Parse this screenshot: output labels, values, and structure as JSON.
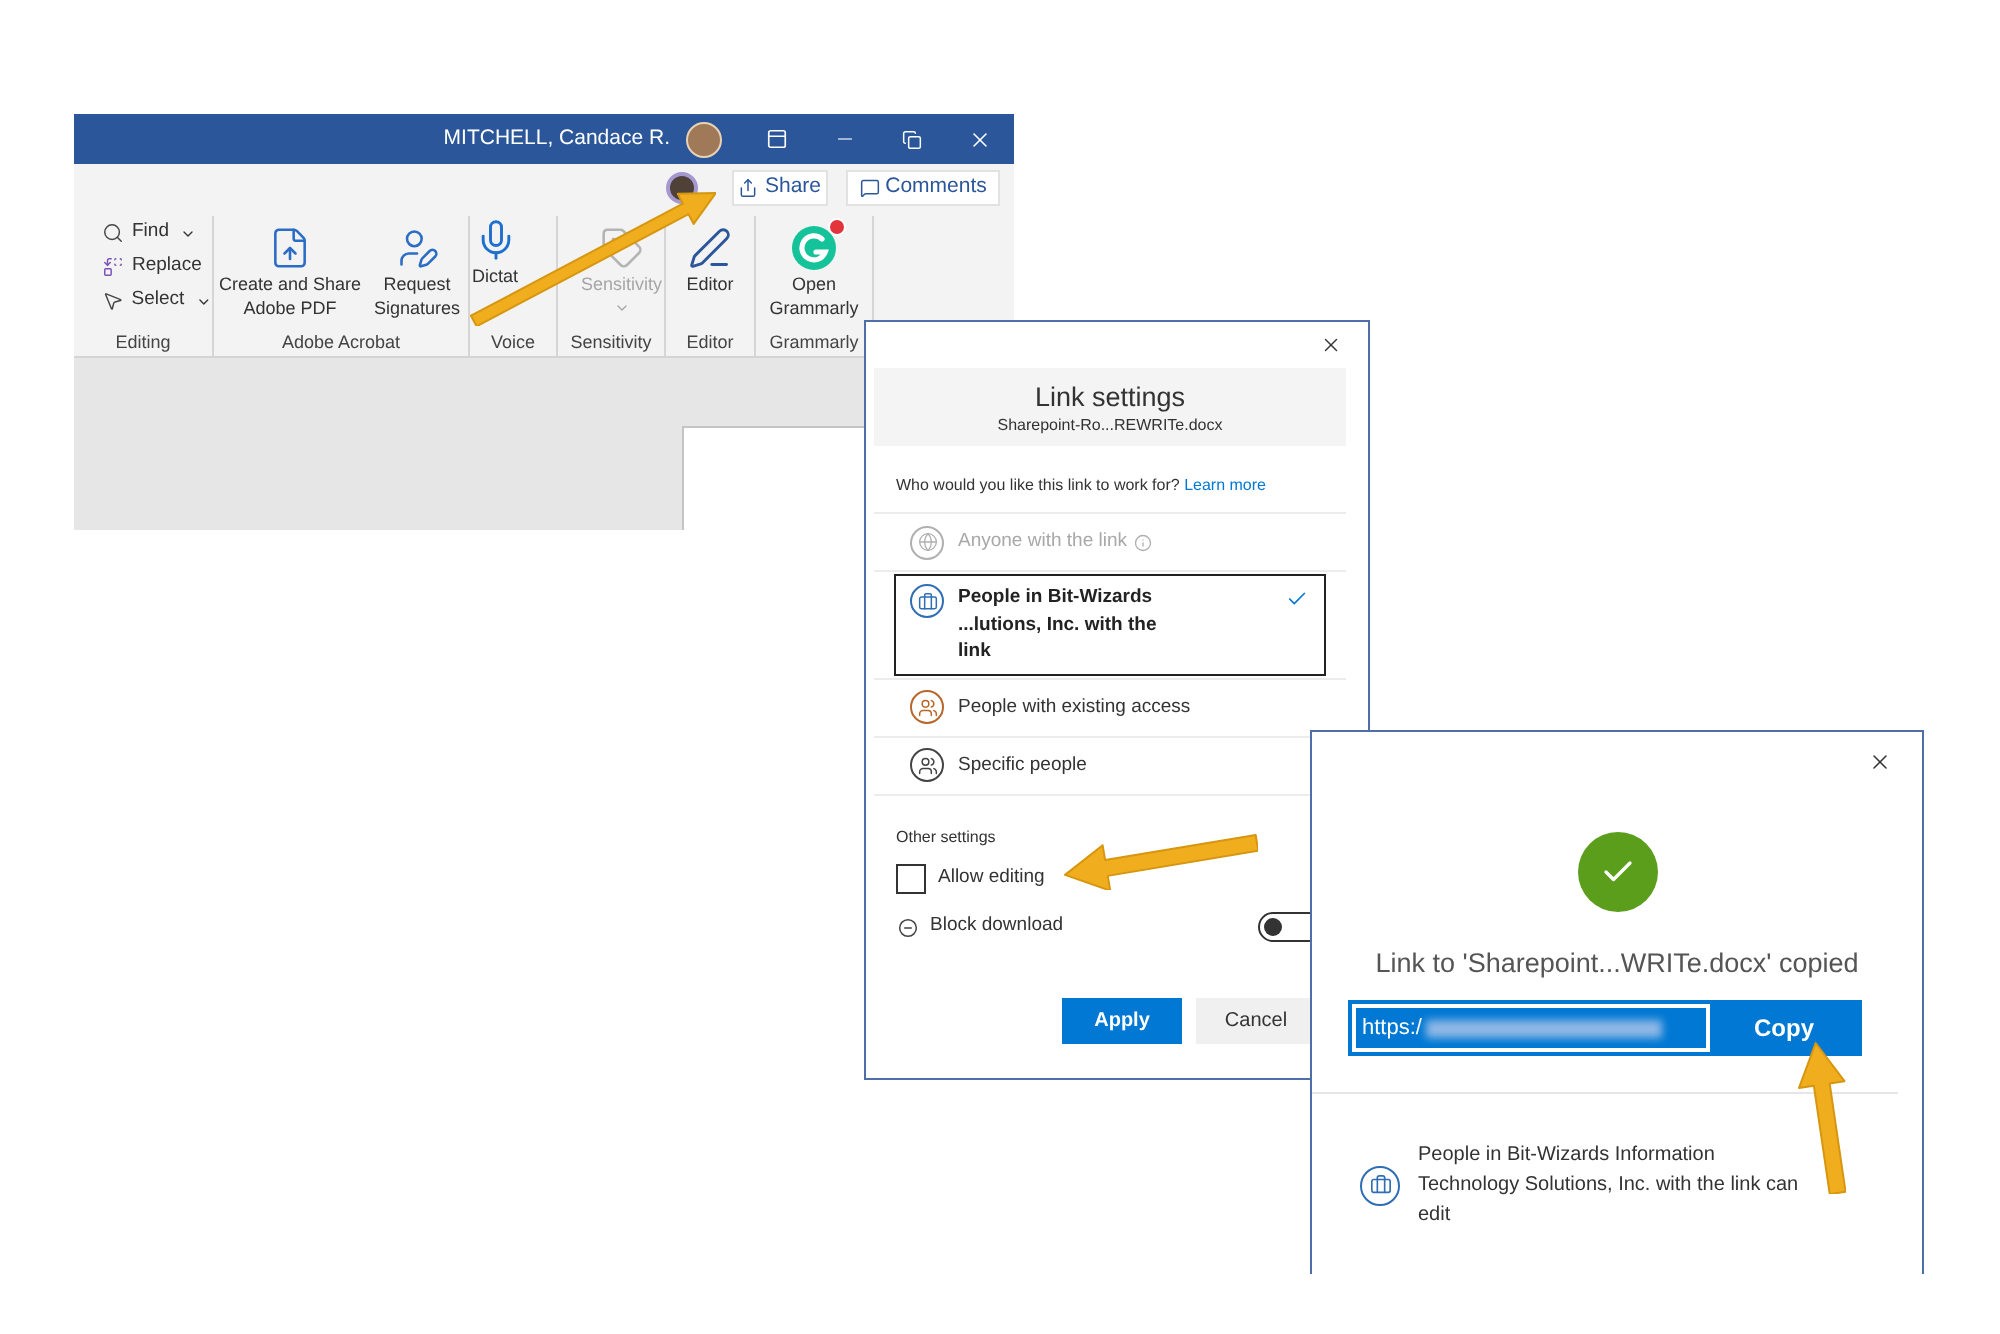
{
  "word_window": {
    "user_name": "MITCHELL, Candace R.",
    "share_button": "Share",
    "comments_button": "Comments",
    "ribbon_groups": [
      {
        "label": "Editing",
        "items": [
          {
            "kind": "small",
            "label": "Find",
            "dropdown": true,
            "disabled": false
          },
          {
            "kind": "small",
            "label": "Replace",
            "dropdown": false,
            "disabled": false
          },
          {
            "kind": "small",
            "label": "Select",
            "dropdown": true,
            "disabled": false
          }
        ]
      },
      {
        "label": "Adobe Acrobat",
        "items": [
          {
            "kind": "large",
            "label": "Create and Share Adobe PDF",
            "dropdown": false,
            "disabled": false
          },
          {
            "kind": "large",
            "label": "Request Signatures",
            "dropdown": false,
            "disabled": false
          }
        ]
      },
      {
        "label": "Voice",
        "items": [
          {
            "kind": "large",
            "label": "Dictat",
            "dropdown": false,
            "disabled": false
          }
        ]
      },
      {
        "label": "Sensitivity",
        "items": [
          {
            "kind": "large",
            "label": "Sensitivity",
            "dropdown": true,
            "disabled": true
          }
        ]
      },
      {
        "label": "Editor",
        "items": [
          {
            "kind": "large",
            "label": "Editor",
            "dropdown": false,
            "disabled": false
          }
        ]
      },
      {
        "label": "Grammarly",
        "items": [
          {
            "kind": "large",
            "label": "Open Grammarly",
            "dropdown": false,
            "disabled": false
          }
        ]
      }
    ]
  },
  "link_settings_dialog": {
    "title": "Link settings",
    "file_name": "Sharepoint-Ro...REWRITe.docx",
    "question": "Who would you like this link to work for?",
    "learn_more_link": "Learn more",
    "audience_options": [
      {
        "label": "Anyone with the link",
        "selected": false,
        "disabled": true
      },
      {
        "label": "People in Bit-Wizards ...lutions, Inc. with the link",
        "selected": true,
        "disabled": false
      },
      {
        "label": "People with existing access",
        "selected": false,
        "disabled": false
      },
      {
        "label": "Specific people",
        "selected": false,
        "disabled": false
      }
    ],
    "other_settings_heading": "Other settings",
    "settings": [
      {
        "kind": "checkbox",
        "label": "Allow editing",
        "checked": false
      },
      {
        "kind": "toggle",
        "label": "Block download",
        "on": false
      }
    ],
    "buttons": [
      {
        "label": "Apply",
        "primary": true
      },
      {
        "label": "Cancel",
        "primary": false
      }
    ]
  },
  "link_copied_dialog": {
    "message": "Link to 'Sharepoint...WRITe.docx' copied",
    "link_field": {
      "value": "https:/",
      "text_selected": true
    },
    "copy_button": "Copy",
    "permission": "People in Bit-Wizards Information Technology Solutions, Inc. with the link can edit"
  }
}
